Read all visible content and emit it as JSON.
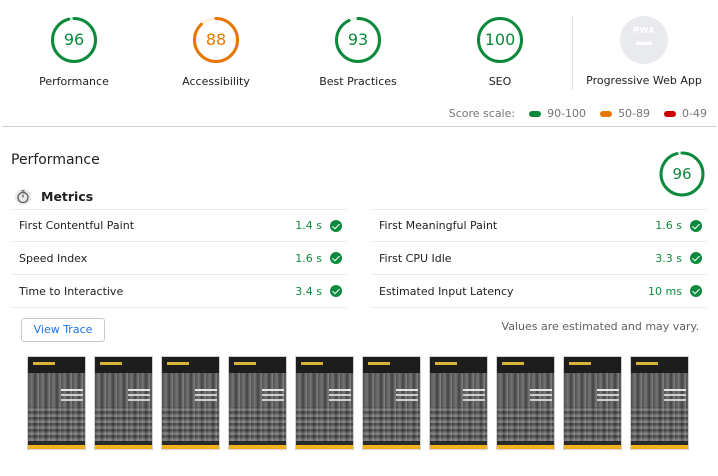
{
  "categories": [
    {
      "label": "Performance",
      "score": "96",
      "value": 96,
      "color": "#0c8a3b"
    },
    {
      "label": "Accessibility",
      "score": "88",
      "value": 88,
      "color": "#e67700"
    },
    {
      "label": "Best Practices",
      "score": "93",
      "value": 93,
      "color": "#0c8a3b"
    },
    {
      "label": "SEO",
      "score": "100",
      "value": 100,
      "color": "#0c8a3b"
    },
    {
      "label": "Progressive Web App",
      "badge": "PWA"
    }
  ],
  "score_scale": {
    "title": "Score scale:",
    "ranges": [
      {
        "label": "90-100",
        "color": "#0c8a3b"
      },
      {
        "label": "50-89",
        "color": "#e67700"
      },
      {
        "label": "0-49",
        "color": "#cc0000"
      }
    ]
  },
  "performance": {
    "title": "Performance",
    "score": "96",
    "value": 96,
    "metrics_title": "Metrics",
    "metrics": [
      {
        "label": "First Contentful Paint",
        "value": "1.4 s"
      },
      {
        "label": "First Meaningful Paint",
        "value": "1.6 s"
      },
      {
        "label": "Speed Index",
        "value": "1.6 s"
      },
      {
        "label": "First CPU Idle",
        "value": "3.3 s"
      },
      {
        "label": "Time to Interactive",
        "value": "3.4 s"
      },
      {
        "label": "Estimated Input Latency",
        "value": "10 ms"
      }
    ],
    "view_trace": "View Trace",
    "note": "Values are estimated and may vary.",
    "filmstrip_frames": 10
  },
  "icons": {
    "metrics": "stopwatch-icon",
    "pass": "check-circle-icon"
  }
}
